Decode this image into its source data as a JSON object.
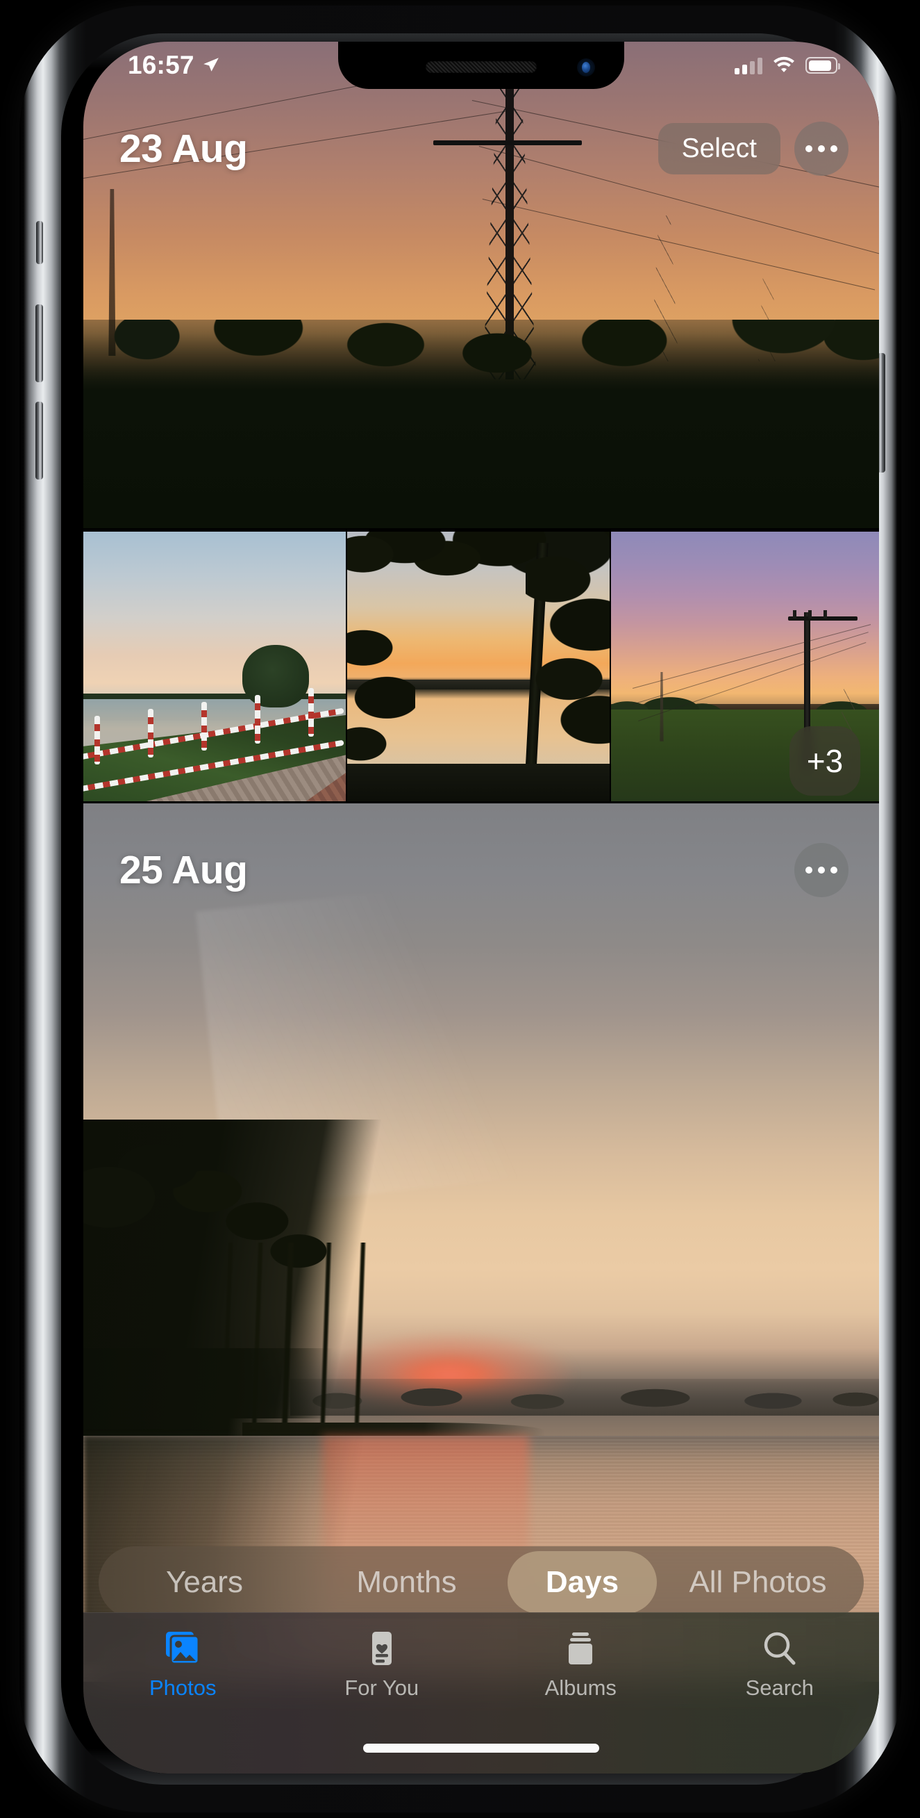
{
  "app": {
    "name": "Photos"
  },
  "status_bar": {
    "time": "16:57",
    "location_icon": "location-arrow-icon",
    "cellular_icon": "cellular-signal-icon",
    "cellular_bars_filled": 2,
    "cellular_bars_total": 4,
    "wifi_icon": "wifi-icon",
    "battery_icon": "battery-icon",
    "battery_percent": 78
  },
  "sections": [
    {
      "date_label": "23 Aug",
      "select_label": "Select",
      "more_icon": "ellipsis-icon",
      "hero_photo": "sunset-power-pylon-treeline",
      "thumbnails": [
        {
          "name": "lake-with-red-white-fence"
        },
        {
          "name": "lake-sunset-through-trees"
        },
        {
          "name": "purple-sunset-utility-pole-field"
        }
      ],
      "overflow_badge": "+3"
    },
    {
      "date_label": "25 Aug",
      "more_icon": "ellipsis-icon",
      "hero_photo": "hazy-lake-sunrise-reflection"
    }
  ],
  "segmented_control": {
    "options": [
      "Years",
      "Months",
      "Days",
      "All Photos"
    ],
    "selected": "Days"
  },
  "tab_bar": {
    "tabs": [
      {
        "label": "Photos",
        "icon": "photos-stack-icon",
        "active": true
      },
      {
        "label": "For You",
        "icon": "heart-card-icon",
        "active": false
      },
      {
        "label": "Albums",
        "icon": "albums-folder-icon",
        "active": false
      },
      {
        "label": "Search",
        "icon": "magnifier-icon",
        "active": false
      }
    ]
  },
  "colors": {
    "accent": "#0a84ff",
    "tab_inactive": "#b8b7b3",
    "segment_active_bg": "#bca688",
    "overlay_chrome": "#766a64"
  },
  "home_indicator": "home-indicator"
}
